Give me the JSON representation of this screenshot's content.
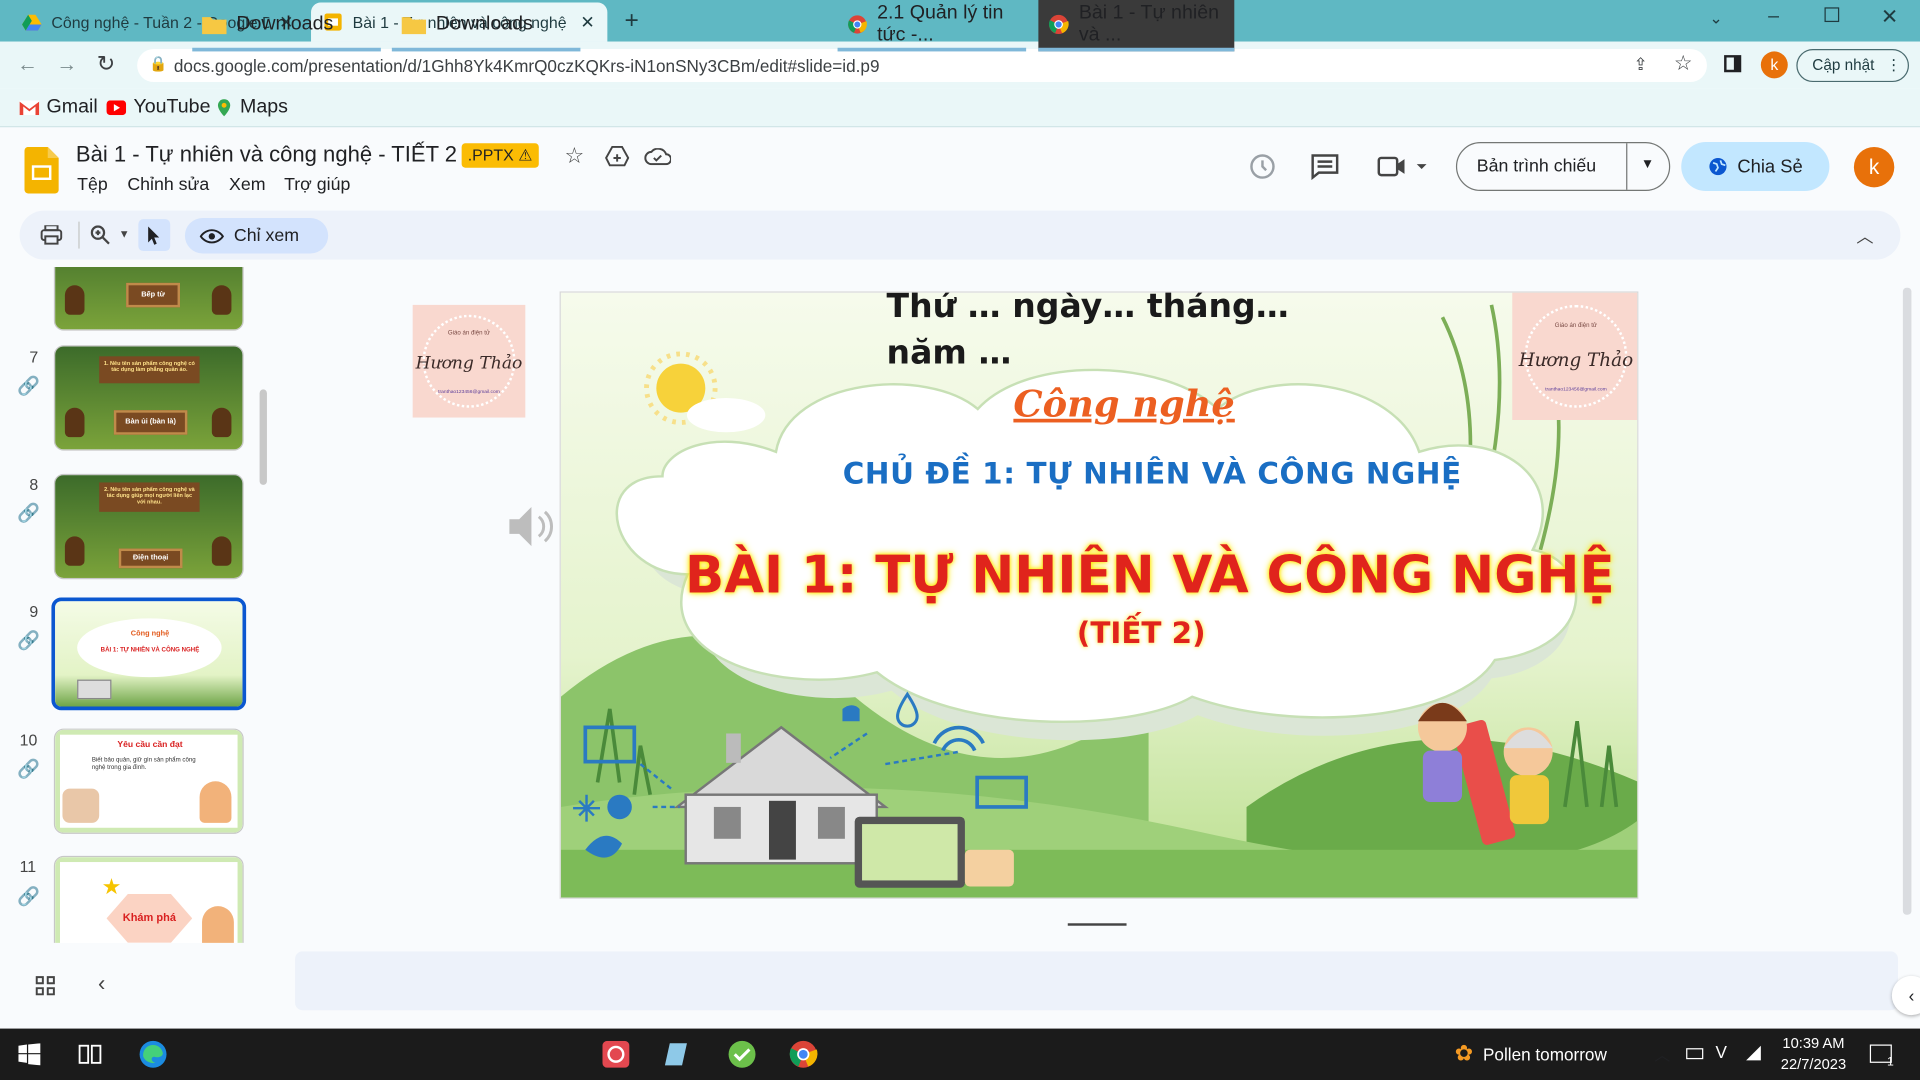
{
  "browser": {
    "tabs": [
      {
        "title": "Công nghệ - Tuần 2 - Google Dri"
      },
      {
        "title": "Bài 1 - Tự nhiên và công nghệ - T"
      }
    ],
    "url": "docs.google.com/presentation/d/1Ghh8Yk4KmrQ0czKQKrs-iN1onSNy3CBm/edit#slide=id.p9",
    "profile_initial": "k",
    "update_label": "Cập nhật",
    "bookmarks": [
      "Gmail",
      "YouTube",
      "Maps"
    ]
  },
  "doc": {
    "title": "Bài 1 - Tự nhiên và công nghệ - TIẾT 2",
    "badge": ".PPTX",
    "menu": [
      "Tệp",
      "Chỉnh sửa",
      "Xem",
      "Trợ giúp"
    ],
    "present_label": "Bản trình chiếu",
    "share_label": "Chia Sẻ",
    "view_mode": "Chỉ xem",
    "avatar": "k"
  },
  "filmstrip": {
    "slides": [
      {
        "num": "",
        "caption": "Bếp từ",
        "kind": "forest"
      },
      {
        "num": "7",
        "caption": "Bàn ủi (bàn là)",
        "q": "1. Nêu tên sản phẩm công nghệ có tác dụng làm phẳng quần áo.",
        "kind": "forest"
      },
      {
        "num": "8",
        "caption": "Điện thoại",
        "q": "2. Nêu tên sản phẩm công nghệ và tác dụng giúp mọi người liên lạc với nhau.",
        "kind": "forest"
      },
      {
        "num": "9",
        "kind": "title",
        "selected": true
      },
      {
        "num": "10",
        "caption": "Yêu cầu cần đạt",
        "q": "Biết bảo quản, giữ gìn sản phẩm công nghệ trong gia đình.",
        "kind": "req"
      },
      {
        "num": "11",
        "caption": "Khám phá",
        "kind": "explore"
      }
    ]
  },
  "slide": {
    "date_line1": "Thứ … ngày… tháng…",
    "date_line2": "năm …",
    "subject": "Công nghệ",
    "topic": "CHỦ ĐỀ 1: TỰ NHIÊN VÀ CÔNG NGHỆ",
    "lesson": "BÀI 1: TỰ NHIÊN VÀ CÔNG NGHỆ",
    "period": "(TIẾT 2)",
    "stamp_top": "Giáo án điện tử",
    "stamp_name": "Hương Thảo",
    "stamp_email": "tranthao123456@gmail.com"
  },
  "taskbar": {
    "items": [
      "Downloads",
      "Downloads",
      "2.1 Quản lý tin tức -...",
      "Bài 1 - Tự nhiên và ..."
    ],
    "weather": "Pollen tomorrow",
    "time": "10:39 AM",
    "date": "22/7/2023",
    "notification_count": "1"
  }
}
